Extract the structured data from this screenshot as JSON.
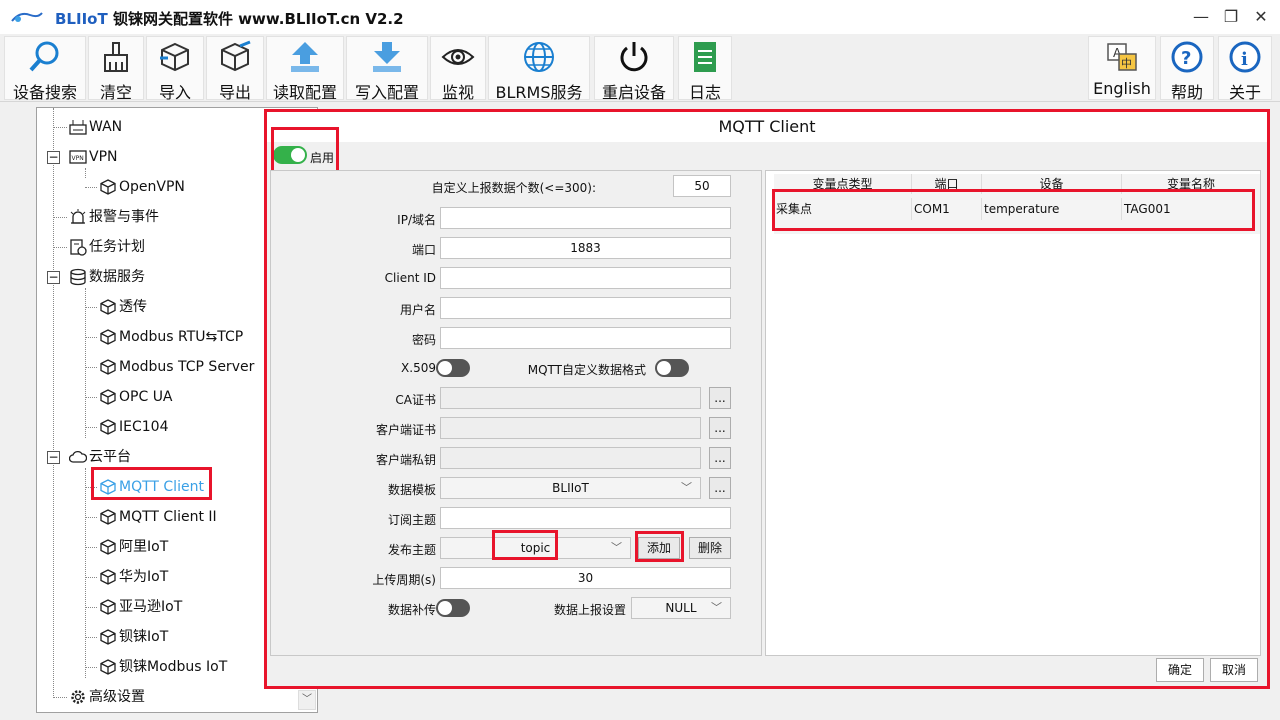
{
  "window": {
    "app_name": "BLIIoT",
    "title_rest": "钡铼网关配置软件 www.BLIIoT.cn V2.2",
    "minimize": "—",
    "maximize": "❐",
    "close": "✕"
  },
  "toolbar": {
    "search": "设备搜索",
    "clear": "清空",
    "import": "导入",
    "export": "导出",
    "read_config": "读取配置",
    "write_config": "写入配置",
    "monitor": "监视",
    "blrms": "BLRMS服务",
    "restart": "重启设备",
    "log": "日志",
    "english": "English",
    "help": "帮助",
    "about": "关于"
  },
  "tree": {
    "wan": "WAN",
    "vpn": "VPN",
    "openvpn": "OpenVPN",
    "alarm": "报警与事件",
    "task": "任务计划",
    "data_service": "数据服务",
    "passthrough": "透传",
    "modbus_rtu_tcp": "Modbus RTU⇆TCP",
    "modbus_tcp_server": "Modbus TCP Server",
    "opc_ua": "OPC UA",
    "iec104": "IEC104",
    "cloud": "云平台",
    "mqtt_client": "MQTT Client",
    "mqtt_client_ii": "MQTT Client II",
    "aliyun": "阿里IoT",
    "huawei": "华为IoT",
    "aws": "亚马逊IoT",
    "bliiot": "钡铼IoT",
    "bliiot_modbus": "钡铼Modbus IoT",
    "advanced": "高级设置",
    "scroll_down": "﹀"
  },
  "panel": {
    "title": "MQTT Client",
    "enable_label": "启用",
    "enabled": true
  },
  "form": {
    "upload_count_label": "自定义上报数据个数(<=300):",
    "upload_count": "50",
    "ip_label": "IP/域名",
    "ip": "",
    "port_label": "端口",
    "port": "1883",
    "clientid_label": "Client ID",
    "clientid": "",
    "username_label": "用户名",
    "username": "",
    "password_label": "密码",
    "password": "",
    "x509_label": "X.509",
    "x509": false,
    "custom_format_label": "MQTT自定义数据格式",
    "custom_format": false,
    "ca_label": "CA证书",
    "client_cert_label": "客户端证书",
    "client_key_label": "客户端私钥",
    "browse": "...",
    "template_label": "数据模板",
    "template": "BLIIoT",
    "subscribe_label": "订阅主题",
    "subscribe": "",
    "publish_label": "发布主题",
    "publish": "topic",
    "add": "添加",
    "delete": "删除",
    "period_label": "上传周期(s)",
    "period": "30",
    "resend_label": "数据补传",
    "resend": false,
    "report_setting_label": "数据上报设置",
    "report_setting": "NULL"
  },
  "grid": {
    "headers": [
      "变量点类型",
      "端口",
      "设备",
      "变量名称"
    ],
    "rows": [
      [
        "采集点",
        "COM1",
        "temperature",
        "TAG001"
      ]
    ]
  },
  "footer": {
    "ok": "确定",
    "cancel": "取消"
  },
  "colors": {
    "highlight": "#e8142b",
    "toggle_on": "#34b14a",
    "selected_item": "#3aa0e6"
  }
}
